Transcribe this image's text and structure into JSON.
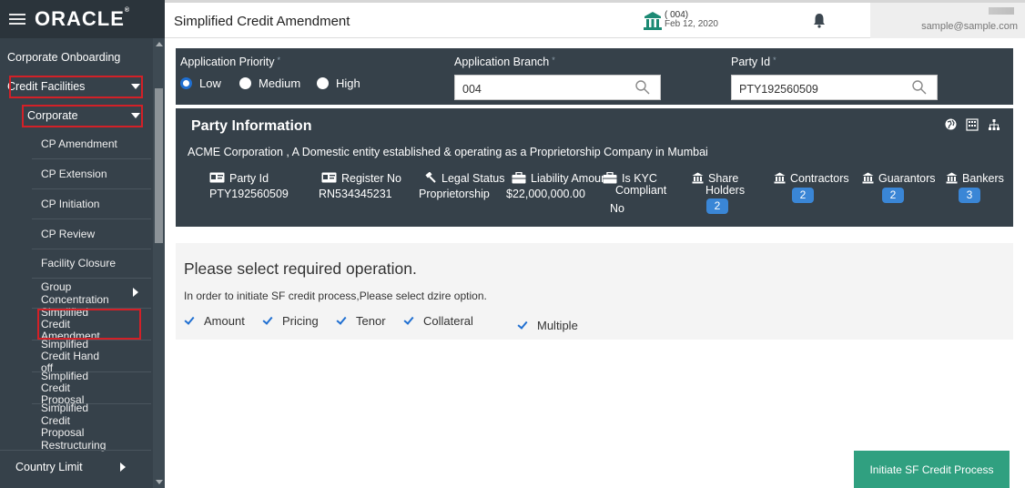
{
  "app": {
    "logo": "ORACLE",
    "logo_mark": "®"
  },
  "header": {
    "title": "Simplified Credit Amendment",
    "branch_code": "( 004)",
    "branch_date": "Feb 12, 2020",
    "user_email": "sample@sample.com"
  },
  "sidebar": {
    "items": [
      {
        "label": "Corporate Onboarding"
      },
      {
        "label": "Credit Facilities"
      },
      {
        "label": "Corporate"
      },
      {
        "label": "CP Amendment"
      },
      {
        "label": "CP Extension"
      },
      {
        "label": "CP Initiation"
      },
      {
        "label": "CP Review"
      },
      {
        "label": "Facility Closure"
      },
      {
        "label": "Group Concentration"
      },
      {
        "label": "Simplified Credit Amendment"
      },
      {
        "label": "Simplified Credit Hand off"
      },
      {
        "label": "Simplified Credit Proposal"
      },
      {
        "label": "Simplified Credit Proposal Restructuring"
      },
      {
        "label": "Country Limit"
      }
    ]
  },
  "form": {
    "priority_label": "Application Priority",
    "priority_options": [
      "Low",
      "Medium",
      "High"
    ],
    "priority_selected": "Low",
    "branch_label": "Application Branch",
    "branch_value": "004",
    "party_label": "Party Id",
    "party_value": "PTY192560509"
  },
  "party": {
    "title": "Party Information",
    "description": "ACME Corporation , A Domestic entity established & operating as a Proprietorship Company in Mumbai",
    "fields": [
      {
        "label": "Party Id",
        "value": "PTY192560509"
      },
      {
        "label": "Register No",
        "value": "RN534345231"
      },
      {
        "label": "Legal Status",
        "value": "Proprietorship"
      },
      {
        "label": "Liability Amount",
        "value": "$22,000,000.00"
      },
      {
        "label": "Is KYC Compliant",
        "label_line1": "Is KYC",
        "label_line2": "Compliant",
        "value": "No"
      }
    ],
    "counts": [
      {
        "label_line1": "Share",
        "label_line2": "Holders",
        "count": "2"
      },
      {
        "label": "Contractors",
        "count": "2"
      },
      {
        "label": "Guarantors",
        "count": "2"
      },
      {
        "label": "Bankers",
        "count": "3"
      }
    ]
  },
  "operations": {
    "title": "Please select required operation.",
    "hint": "In order to initiate SF credit process,Please select dzire option.",
    "options": [
      {
        "label": "Amount",
        "checked": true
      },
      {
        "label": "Pricing",
        "checked": true
      },
      {
        "label": "Tenor",
        "checked": true
      },
      {
        "label": "Collateral",
        "checked": true
      },
      {
        "label": "Multiple",
        "checked": true
      }
    ]
  },
  "actions": {
    "initiate_label": "Initiate SF Credit Process"
  },
  "colors": {
    "sidebar_bg": "#36414a",
    "accent": "#30a080",
    "highlight": "#d32027",
    "badge": "#3a86d6"
  }
}
